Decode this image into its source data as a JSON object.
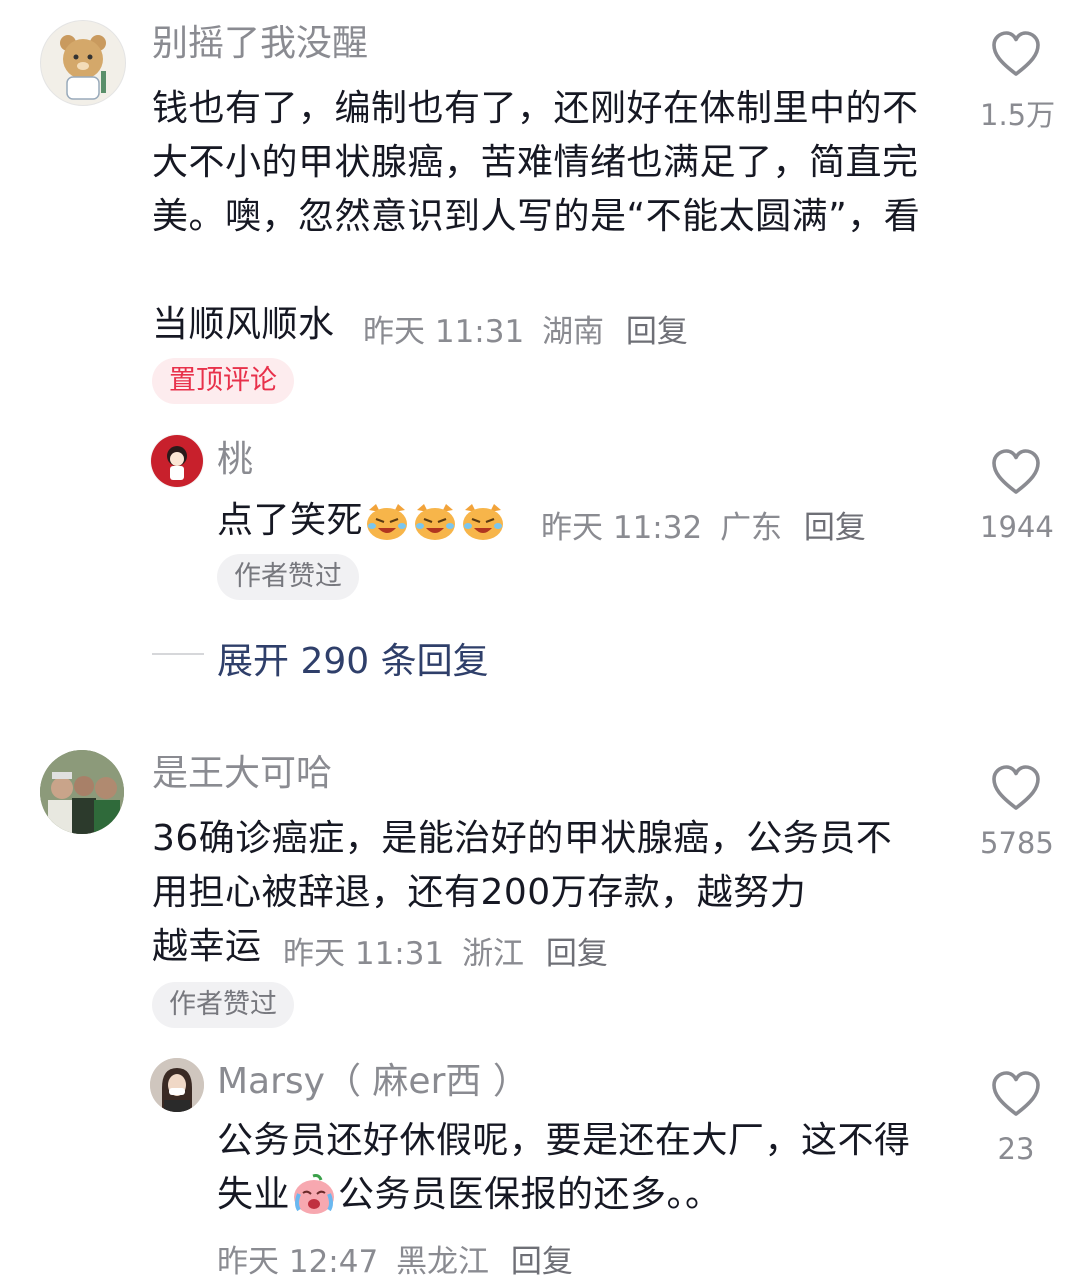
{
  "comments": [
    {
      "username": "别摇了我没醒",
      "text": "钱也有了，编制也有了，还刚好在体制里中的不大不小的甲状腺癌，苦难情绪也满足了，简直完美。噢，忽然意识到人写的是“不能太圆满”，看来他也知道自己过得相当顺风顺水",
      "time": "昨天 11:31",
      "location": "湖南",
      "reply_label": "回复",
      "likes": "1.5万",
      "tag": "置顶评论",
      "avatar_icon": "cartoon-bear-avatar"
    },
    {
      "username": "是王大可哈",
      "text": "36确诊癌症，是能治好的甲状腺癌，公务员不用担心被辞退，还有200万存款，越努力越幸运",
      "time": "昨天 11:31",
      "location": "浙江",
      "reply_label": "回复",
      "likes": "5785",
      "tag": "作者赞过",
      "avatar_icon": "group-photo-avatar"
    }
  ],
  "replies": [
    {
      "username": "桃",
      "text": "点了笑死",
      "emoji": "crying-laughing-cat-emoji",
      "time": "昨天 11:32",
      "location": "广东",
      "reply_label": "回复",
      "likes": "1944",
      "tag": "作者赞过",
      "avatar_icon": "cartoon-girl-avatar"
    },
    {
      "username": "Marsy（ 麻er西 ）",
      "text_before_emoji": "公务员还好休假呢，要是还在大厂，这不得失业",
      "emoji": "crying-face-emoji",
      "text_after_emoji": "公务员医保报的还多。。",
      "time": "昨天 12:47",
      "location": "黑龙江",
      "reply_label": "回复",
      "likes": "23",
      "avatar_icon": "woman-photo-avatar"
    }
  ],
  "expand": {
    "label": "展开 290 条回复"
  },
  "colors": {
    "username": "#8a8b91",
    "content": "#161823",
    "pinned_tag_bg": "#fdecee",
    "pinned_tag_text": "#e8314b",
    "expand_text": "#2f3f6a"
  }
}
